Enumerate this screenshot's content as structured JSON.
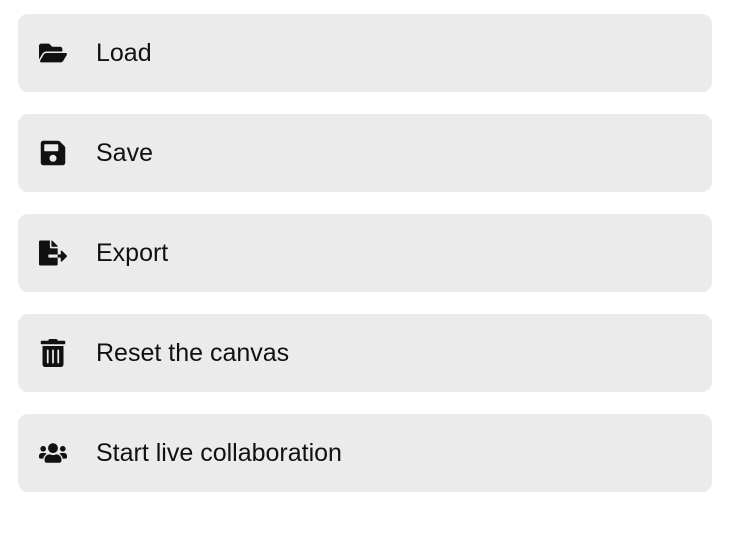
{
  "menu": {
    "items": [
      {
        "id": "load",
        "label": "Load",
        "icon": "folder-open-icon"
      },
      {
        "id": "save",
        "label": "Save",
        "icon": "save-icon"
      },
      {
        "id": "export",
        "label": "Export",
        "icon": "export-icon"
      },
      {
        "id": "reset",
        "label": "Reset the canvas",
        "icon": "trash-icon"
      },
      {
        "id": "collab",
        "label": "Start live collaboration",
        "icon": "users-icon"
      }
    ]
  }
}
